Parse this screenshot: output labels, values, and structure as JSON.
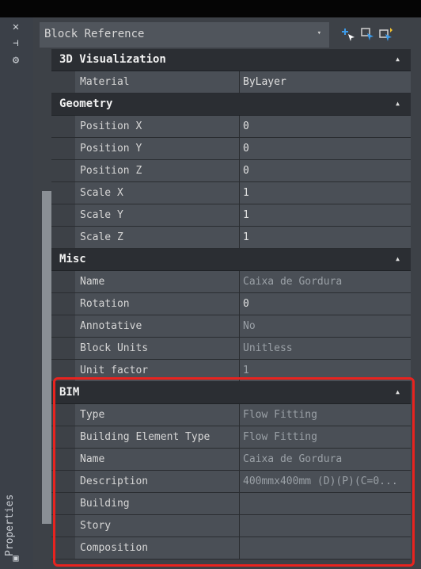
{
  "panel": {
    "title": "Properties",
    "close_glyph": "✕",
    "pin_glyph": "⊣",
    "settings_glyph": "⚙",
    "bottom_glyph": "▣"
  },
  "header": {
    "selector_value": "Block Reference",
    "selector_arrow": "▾",
    "buttons": [
      {
        "icon": "select-objects-icon"
      },
      {
        "icon": "quick-select-icon"
      },
      {
        "icon": "toggle-pickadd-icon"
      }
    ]
  },
  "sections": [
    {
      "title": "3D Visualization",
      "collapse": "▲",
      "rows": [
        {
          "name": "Material",
          "value": "ByLayer",
          "dim": false
        }
      ]
    },
    {
      "title": "Geometry",
      "collapse": "▲",
      "rows": [
        {
          "name": "Position X",
          "value": "0",
          "dim": false
        },
        {
          "name": "Position Y",
          "value": "0",
          "dim": false
        },
        {
          "name": "Position Z",
          "value": "0",
          "dim": false
        },
        {
          "name": "Scale X",
          "value": "1",
          "dim": false
        },
        {
          "name": "Scale Y",
          "value": "1",
          "dim": false
        },
        {
          "name": "Scale Z",
          "value": "1",
          "dim": false
        }
      ]
    },
    {
      "title": "Misc",
      "collapse": "▲",
      "rows": [
        {
          "name": "Name",
          "value": "Caixa de Gordura",
          "dim": true
        },
        {
          "name": "Rotation",
          "value": "0",
          "dim": false
        },
        {
          "name": "Annotative",
          "value": "No",
          "dim": true
        },
        {
          "name": "Block Units",
          "value": "Unitless",
          "dim": true
        },
        {
          "name": "Unit factor",
          "value": "1",
          "dim": true
        }
      ]
    },
    {
      "title": "BIM",
      "collapse": "▲",
      "rows": [
        {
          "name": "Type",
          "value": "Flow Fitting",
          "dim": true
        },
        {
          "name": "Building Element Type",
          "value": "Flow Fitting",
          "dim": true
        },
        {
          "name": "Name",
          "value": "Caixa de Gordura",
          "dim": true
        },
        {
          "name": "Description",
          "value": "400mmx400mm (D)(P)(C=0...",
          "dim": true
        },
        {
          "name": "Building",
          "value": "",
          "dim": true
        },
        {
          "name": "Story",
          "value": "",
          "dim": true
        },
        {
          "name": "Composition",
          "value": "",
          "dim": true
        }
      ]
    }
  ],
  "colors": {
    "highlight": "#e8231f",
    "accent_blue": "#3d9be9",
    "accent_yellow": "#f2c230"
  }
}
